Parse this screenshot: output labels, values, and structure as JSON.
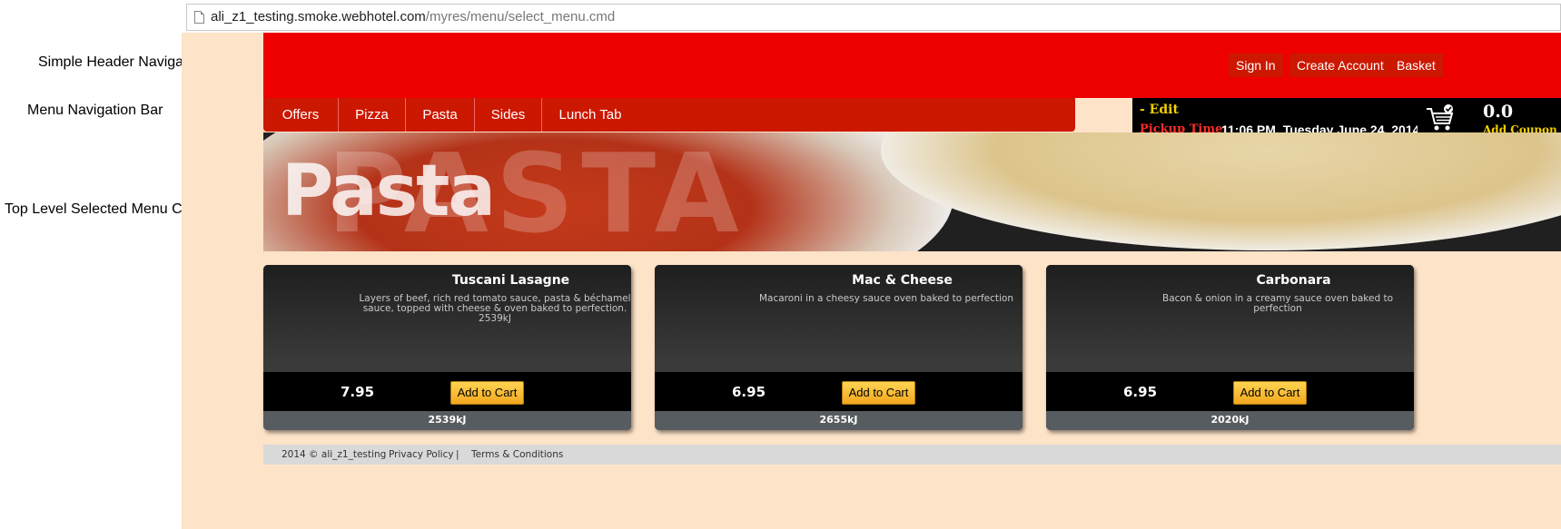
{
  "annotations": {
    "header_nav": "Simple Header Navigation",
    "menu_nav": "Menu Navigation Bar",
    "category": "Top Level Selected Menu Category"
  },
  "browser": {
    "url_domain": "ali_z1_testing.smoke.webhotel.com",
    "url_path": "/myres/menu/select_menu.cmd"
  },
  "header": {
    "sign_in": "Sign In",
    "create_account": "Create Account",
    "basket": "Basket"
  },
  "menu": {
    "items": [
      "Offers",
      "Pizza",
      "Pasta",
      "Sides",
      "Lunch Tab"
    ]
  },
  "pickup": {
    "edit": "- Edit",
    "label": "Pickup Time:",
    "time": "11:06 PM, Tuesday June 24, 2014"
  },
  "cart": {
    "total": "0.0",
    "coupon": "Add Coupon"
  },
  "banner": {
    "title": "Pasta",
    "big_text": "PASTA"
  },
  "products": [
    {
      "name": "Tuscani Lasagne",
      "desc": "Layers of beef, rich red tomato sauce, pasta & béchamel sauce, topped with cheese & oven baked to perfection.",
      "desc_kj": "2539kJ",
      "price": "7.95",
      "add_label": "Add to Cart",
      "kj": "2539kJ"
    },
    {
      "name": "Mac & Cheese",
      "desc": "Macaroni in a cheesy sauce oven baked to perfection",
      "desc_kj": "",
      "price": "6.95",
      "add_label": "Add to Cart",
      "kj": "2655kJ"
    },
    {
      "name": "Carbonara",
      "desc": "Bacon & onion in a creamy sauce oven baked to perfection",
      "desc_kj": "",
      "price": "6.95",
      "add_label": "Add to Cart",
      "kj": "2020kJ"
    }
  ],
  "footer": {
    "copyright": "2014 © ali_z1_testing",
    "privacy": "Privacy Policy",
    "separator": "|",
    "terms": "Terms & Conditions"
  },
  "colors": {
    "header_red": "#ee0000",
    "nav_red": "#cc1800",
    "page_bg": "#fde3c8",
    "button_gold": "#f2a71f"
  }
}
